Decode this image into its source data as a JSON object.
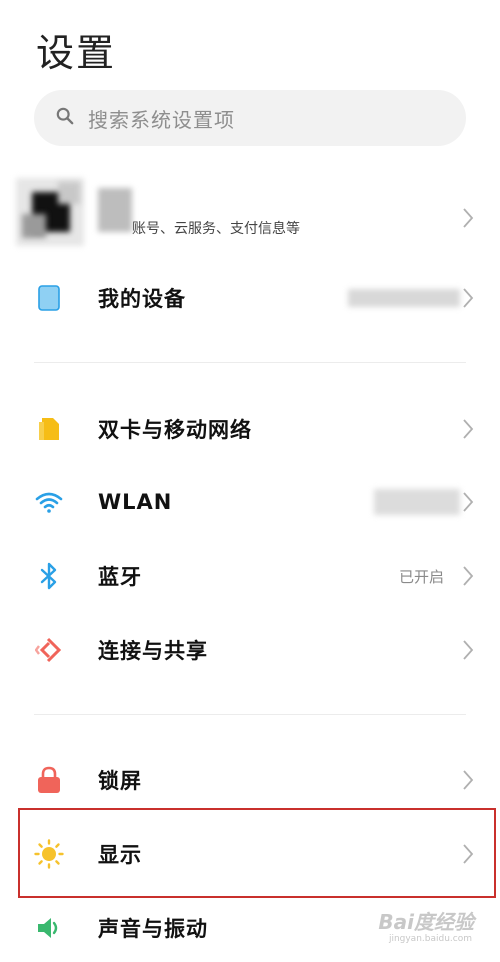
{
  "header": {
    "title": "设置"
  },
  "search": {
    "placeholder": "搜索系统设置项"
  },
  "account": {
    "subtitle": "账号、云服务、支付信息等"
  },
  "rows": [
    {
      "label": "我的设备",
      "value": "",
      "icon": "tablet-icon"
    },
    {
      "label": "双卡与移动网络",
      "value": "",
      "icon": "sim-card-icon"
    },
    {
      "label": "WLAN",
      "value": "",
      "icon": "wifi-icon"
    },
    {
      "label": "蓝牙",
      "value": "已开启",
      "icon": "bluetooth-icon"
    },
    {
      "label": "连接与共享",
      "value": "",
      "icon": "connection-share-icon"
    },
    {
      "label": "锁屏",
      "value": "",
      "icon": "lock-icon"
    },
    {
      "label": "显示",
      "value": "",
      "icon": "brightness-icon"
    },
    {
      "label": "声音与振动",
      "value": "",
      "icon": "speaker-icon"
    }
  ],
  "watermark": {
    "text": "Bai度经验",
    "sub": "jingyan.baidu.com"
  },
  "colors": {
    "accent_blue": "#2aa0e6",
    "highlight_red": "#c9302c",
    "sim_yellow": "#f6bd16",
    "lock_red": "#f0645a",
    "sun_yellow": "#f6c22c",
    "sound_green": "#39b86e"
  }
}
